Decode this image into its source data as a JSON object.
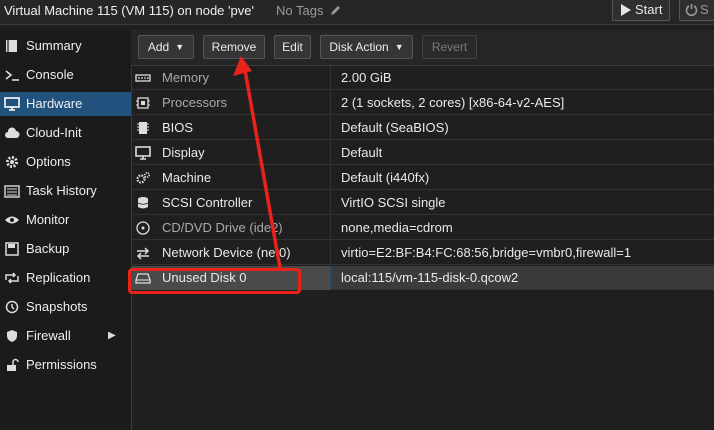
{
  "header": {
    "title": "Virtual Machine 115 (VM 115) on node 'pve'",
    "tags": "No Tags",
    "start_label": "Start",
    "shutdown_label": "S"
  },
  "sidebar": {
    "items": [
      {
        "label": "Summary",
        "icon": "book-icon"
      },
      {
        "label": "Console",
        "icon": "terminal-icon"
      },
      {
        "label": "Hardware",
        "icon": "desktop-icon",
        "active": true
      },
      {
        "label": "Cloud-Init",
        "icon": "cloud-icon"
      },
      {
        "label": "Options",
        "icon": "gear-icon"
      },
      {
        "label": "Task History",
        "icon": "list-icon"
      },
      {
        "label": "Monitor",
        "icon": "eye-icon"
      },
      {
        "label": "Backup",
        "icon": "floppy-icon"
      },
      {
        "label": "Replication",
        "icon": "retweet-icon"
      },
      {
        "label": "Snapshots",
        "icon": "history-icon"
      },
      {
        "label": "Firewall",
        "icon": "shield-icon",
        "has_submenu": true
      },
      {
        "label": "Permissions",
        "icon": "unlock-icon"
      }
    ]
  },
  "toolbar": {
    "add_label": "Add",
    "remove_label": "Remove",
    "edit_label": "Edit",
    "disk_action_label": "Disk Action",
    "revert_label": "Revert"
  },
  "hardware": {
    "rows": [
      {
        "key": "Memory",
        "value": "2.00 GiB",
        "icon": "memory-icon",
        "muted": true
      },
      {
        "key": "Processors",
        "value": "2 (1 sockets, 2 cores) [x86-64-v2-AES]",
        "icon": "cpu-icon",
        "muted": true
      },
      {
        "key": "BIOS",
        "value": "Default (SeaBIOS)",
        "icon": "microchip-icon"
      },
      {
        "key": "Display",
        "value": "Default",
        "icon": "display-icon"
      },
      {
        "key": "Machine",
        "value": "Default (i440fx)",
        "icon": "cogs-icon"
      },
      {
        "key": "SCSI Controller",
        "value": "VirtIO SCSI single",
        "icon": "database-icon"
      },
      {
        "key": "CD/DVD Drive (ide2)",
        "value": "none,media=cdrom",
        "icon": "cdrom-icon",
        "muted": true
      },
      {
        "key": "Network Device (net0)",
        "value": "virtio=E2:BF:B4:FC:68:56,bridge=vmbr0,firewall=1",
        "icon": "exchange-icon"
      },
      {
        "key": "Unused Disk 0",
        "value": "local:115/vm-115-disk-0.qcow2",
        "icon": "hdd-icon",
        "selected": true
      }
    ]
  },
  "annotation": {
    "color": "#e8231c"
  }
}
